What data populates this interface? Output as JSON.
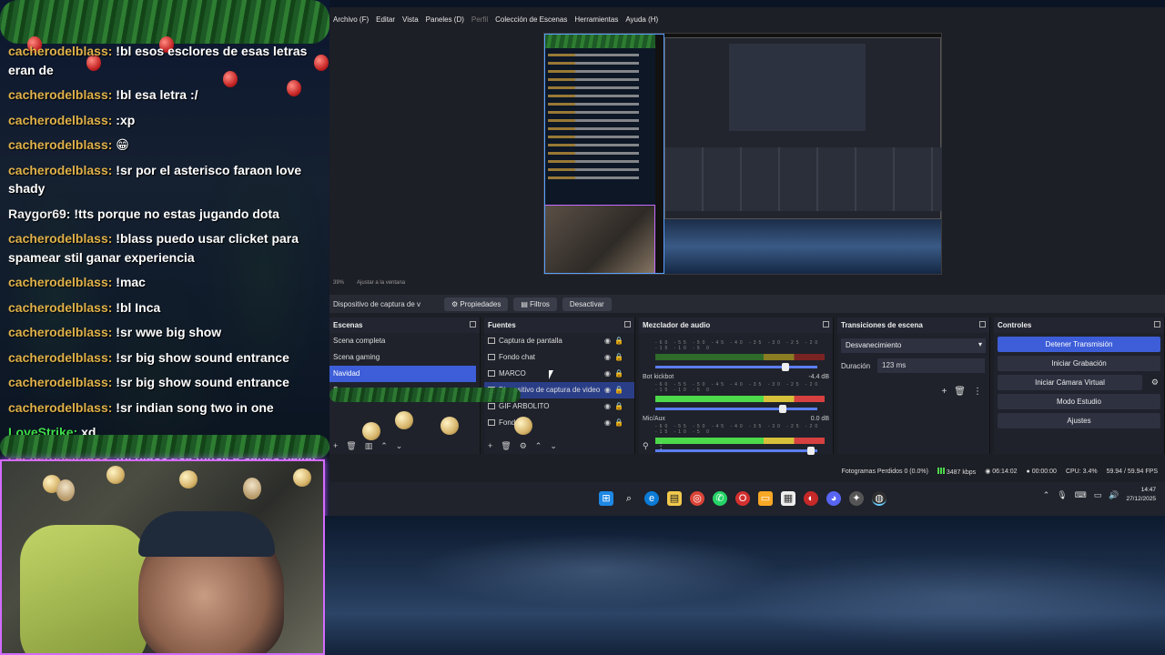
{
  "chat": {
    "messages": [
      {
        "user": "cacherodelblass:",
        "text": " !bl esos esclores de esas letras eran de",
        "color": "gold"
      },
      {
        "user": "cacherodelblass:",
        "text": " !bl esa letra :/",
        "color": "gold"
      },
      {
        "user": "cacherodelblass:",
        "text": " :xp",
        "color": "gold"
      },
      {
        "user": "cacherodelblass:",
        "text": " 😁",
        "color": "gold"
      },
      {
        "user": "cacherodelblass:",
        "text": " !sr por el asterisco faraon love shady",
        "color": "gold"
      },
      {
        "user": "Raygor69:",
        "text": " !tts porque no estas jugando dota",
        "color": "white"
      },
      {
        "user": "cacherodelblass:",
        "text": " !blass puedo usar clicket para spamear stil ganar experiencia",
        "color": "gold"
      },
      {
        "user": "cacherodelblass:",
        "text": " !mac",
        "color": "gold"
      },
      {
        "user": "cacherodelblass:",
        "text": " !bl Inca",
        "color": "gold"
      },
      {
        "user": "cacherodelblass:",
        "text": " !sr wwe big show",
        "color": "gold"
      },
      {
        "user": "cacherodelblass:",
        "text": " !sr big show sound entrance",
        "color": "gold"
      },
      {
        "user": "cacherodelblass:",
        "text": " !sr big show sound entrance",
        "color": "gold"
      },
      {
        "user": "cacherodelblass:",
        "text": " !sr indian song two in one",
        "color": "gold"
      },
      {
        "user": "LoveStrike:",
        "text": " xd",
        "color": "green"
      },
      {
        "user": "cacherodelblass:",
        "text": " !bl blass esa música sabes bailar",
        "color": "gold"
      }
    ]
  },
  "obs": {
    "menu": {
      "file": "Archivo (F)",
      "edit": "Editar",
      "view": "Vista",
      "panels": "Paneles (D)",
      "profile": "Perfil",
      "scene_collection": "Colección de Escenas",
      "tools": "Herramientas",
      "help": "Ayuda (H)"
    },
    "zoom": {
      "level": "39%",
      "fit": "Ajustar a la ventana"
    },
    "props_bar": {
      "source": "Dispositivo de captura de v",
      "properties": "Propiedades",
      "filters": "Filtros",
      "deactivate": "Desactivar"
    },
    "scenes": {
      "title": "Escenas",
      "items": [
        "Scena completa",
        "Scena gaming",
        "Navidad",
        "Sc..."
      ],
      "selected_index": 2
    },
    "sources": {
      "title": "Fuentes",
      "items": [
        "Captura de pantalla",
        "Fondo chat",
        "MARCO",
        "Dispositivo de captura de video",
        "GIF ARBOLITO",
        "Fondo"
      ]
    },
    "mixer": {
      "title": "Mezclador de audio",
      "scale": "-60 -55 -50 -45 -40 -35 -30 -25 -20 -15 -10 -5 0",
      "channels": [
        {
          "name": "",
          "db": "",
          "fader": 0.82
        },
        {
          "name": "Bot kickbot",
          "db": "-4.4 dB",
          "fader": 0.8
        },
        {
          "name": "Mic/Aux",
          "db": "0.0 dB",
          "fader": 0.98
        }
      ]
    },
    "transitions": {
      "title": "Transiciones de escena",
      "type": "Desvanecimiento",
      "duration_label": "Duración",
      "duration_value": "123 ms"
    },
    "controls": {
      "title": "Controles",
      "stop_stream": "Detener Transmisión",
      "start_recording": "Iniciar Grabación",
      "virtual_camera": "Iniciar Cámara Virtual",
      "studio_mode": "Modo Estudio",
      "settings": "Ajustes"
    },
    "status": {
      "dropped": "Fotogramas Perdidos 0 (0.0%)",
      "bitrate": "3487 kbps",
      "stream_time": "06:14:02",
      "rec_time": "00:00:00",
      "cpu": "CPU: 3.4%",
      "fps": "59.94 / 59.94 FPS"
    }
  },
  "taskbar": {
    "time": "14:47",
    "date": "27/12/2025"
  }
}
